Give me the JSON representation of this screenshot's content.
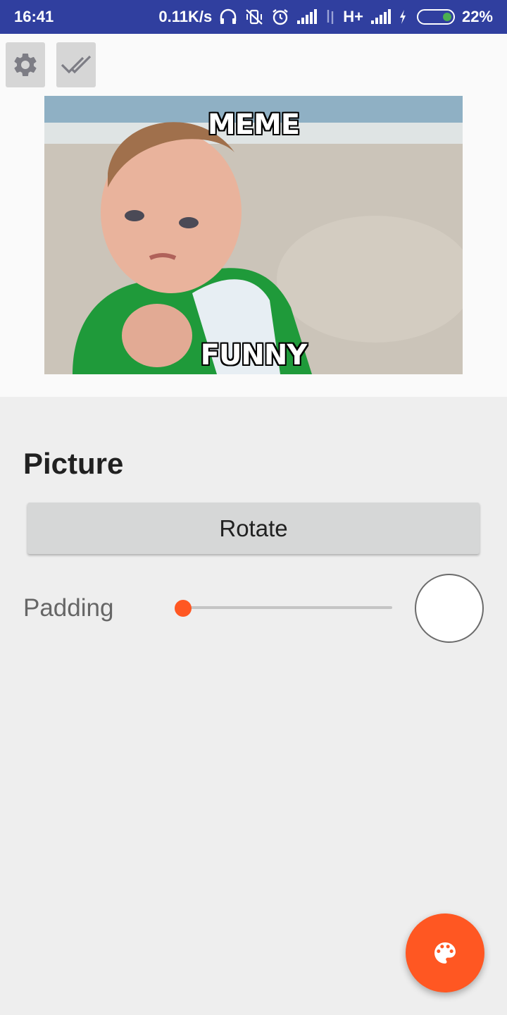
{
  "status_bar": {
    "time": "16:41",
    "network_speed": "0.11K/s",
    "network_type": "H+",
    "battery_percent": "22%",
    "battery_level": 0.22,
    "background_color": "#303f9f",
    "icons": [
      "headphones-icon",
      "vibrate-off-icon",
      "alarm-icon",
      "signal-icon",
      "data-transfer-icon",
      "signal-icon",
      "charging-icon",
      "battery-icon"
    ]
  },
  "toolbar": {
    "settings_icon": "gear-icon",
    "confirm_icon": "double-check-icon"
  },
  "meme": {
    "top_text": "MEME",
    "bottom_text": "FUNNY"
  },
  "picture_section": {
    "title": "Picture",
    "rotate_label": "Rotate",
    "padding_label": "Padding",
    "padding_value": 0,
    "slider_color": "#ff5722",
    "swatch_color": "#ffffff"
  },
  "fab": {
    "icon": "palette-icon",
    "color": "#ff5722"
  }
}
